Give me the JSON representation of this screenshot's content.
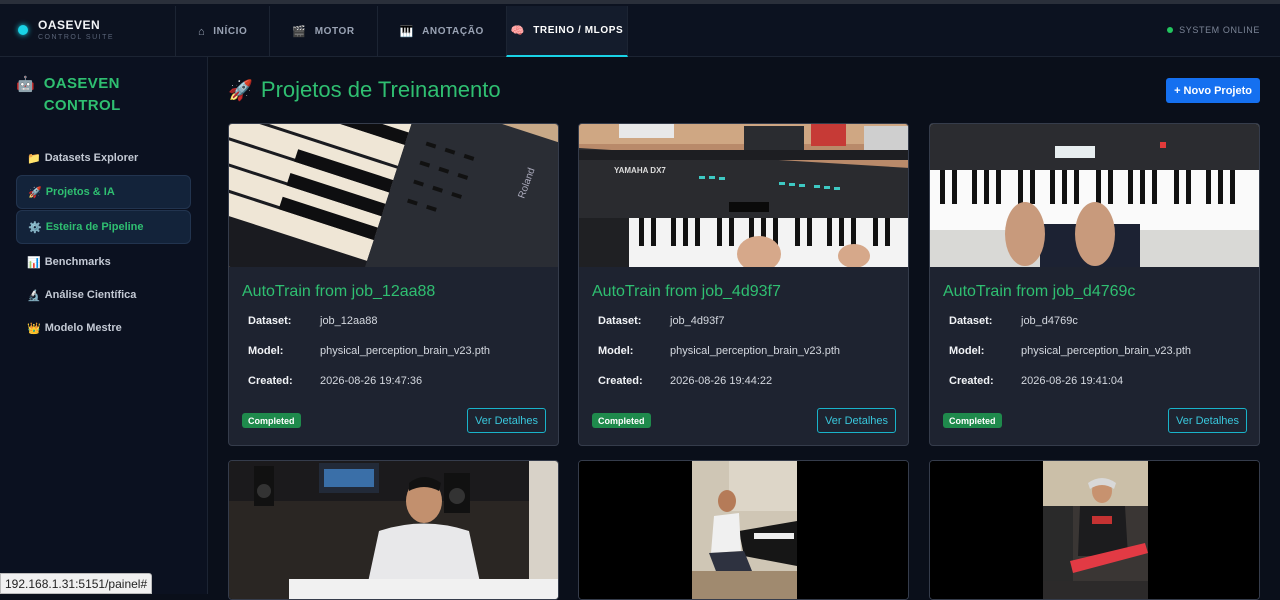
{
  "brand": {
    "name": "OASEVEN",
    "subtitle": "CONTROL SUITE"
  },
  "nav": {
    "tabs": [
      {
        "icon": "⌂",
        "label": "INÍCIO"
      },
      {
        "icon": "🎬",
        "label": "MOTOR"
      },
      {
        "icon": "🎹",
        "label": "ANOTAÇÃO"
      },
      {
        "icon": "🧠",
        "label": "TREINO / MLOPS"
      }
    ],
    "active_tab": "TREINO / MLOPS"
  },
  "system_status": "SYSTEM ONLINE",
  "sidebar": {
    "brand_icon": "🤖",
    "brand_line1": "OASEVEN",
    "brand_line2": "CONTROL",
    "items": [
      {
        "icon": "📁",
        "label": "Datasets Explorer"
      },
      {
        "icon": "🚀",
        "label": "Projetos & IA"
      },
      {
        "icon": "⚙️",
        "label": "Esteira de Pipeline"
      },
      {
        "icon": "📊",
        "label": "Benchmarks"
      },
      {
        "icon": "🔬",
        "label": "Análise Científica"
      },
      {
        "icon": "👑",
        "label": "Modelo Mestre"
      }
    ]
  },
  "main": {
    "title_icon": "🚀",
    "title": "Projetos de Treinamento",
    "new_button": "+ Novo Projeto",
    "cards": [
      {
        "title": "AutoTrain from job_12aa88",
        "dataset_label": "Dataset:",
        "dataset": "job_12aa88",
        "model_label": "Model:",
        "model": "physical_perception_brain_v23.pth",
        "created_label": "Created:",
        "created": "2026-08-26 19:47:36",
        "status": "Completed",
        "details": "Ver Detalhes"
      },
      {
        "title": "AutoTrain from job_4d93f7",
        "dataset_label": "Dataset:",
        "dataset": "job_4d93f7",
        "model_label": "Model:",
        "model": "physical_perception_brain_v23.pth",
        "created_label": "Created:",
        "created": "2026-08-26 19:44:22",
        "status": "Completed",
        "details": "Ver Detalhes"
      },
      {
        "title": "AutoTrain from job_d4769c",
        "dataset_label": "Dataset:",
        "dataset": "job_d4769c",
        "model_label": "Model:",
        "model": "physical_perception_brain_v23.pth",
        "created_label": "Created:",
        "created": "2026-08-26 19:41:04",
        "status": "Completed",
        "details": "Ver Detalhes"
      }
    ],
    "thumb_labels": [
      "Roland",
      "YAMAHA DX7"
    ]
  },
  "status_url": "192.168.1.31:5151/painel#",
  "colors": {
    "accent_green": "#2fbf71",
    "accent_cyan": "#19d3e6",
    "primary_blue": "#1570f0",
    "status_green": "#1f8a4c"
  }
}
